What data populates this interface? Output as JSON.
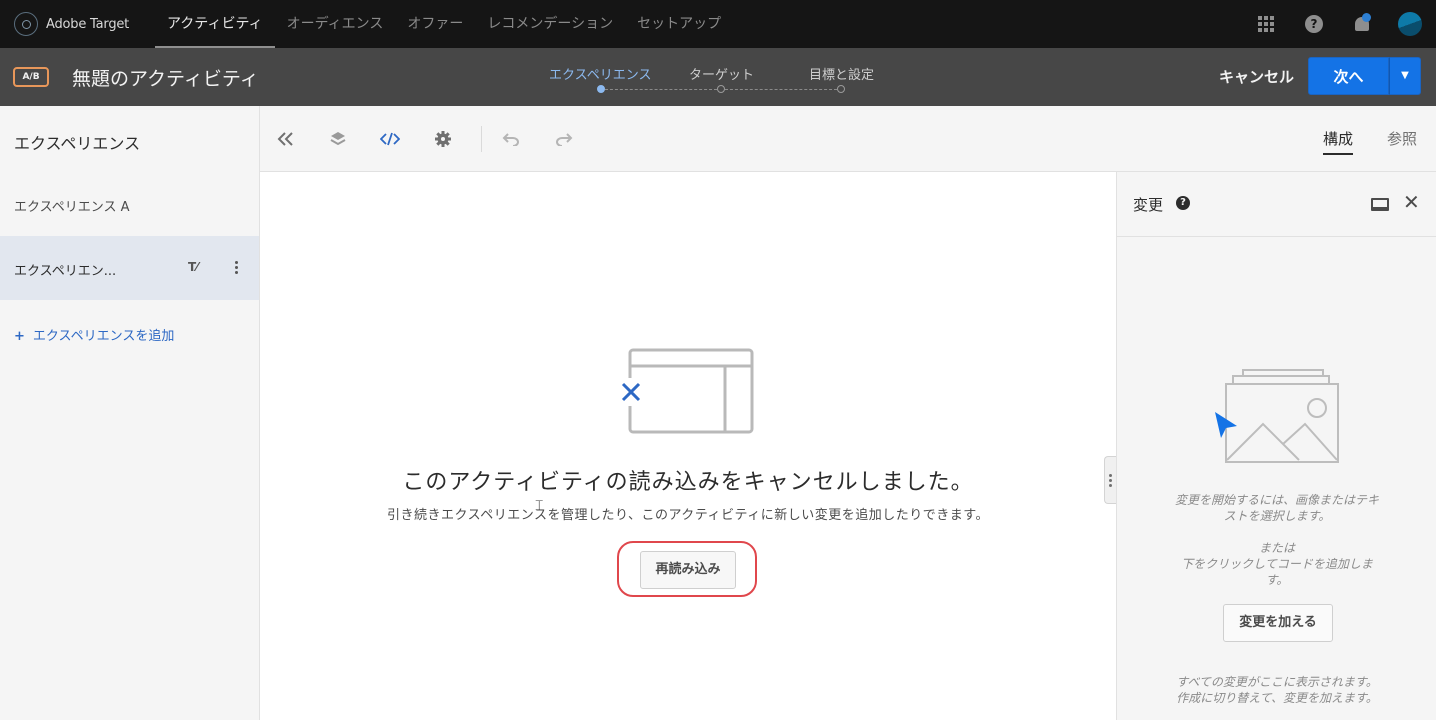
{
  "topnav": {
    "brand": "Adobe Target",
    "tabs": [
      "アクティビティ",
      "オーディエンス",
      "オファー",
      "レコメンデーション",
      "セットアップ"
    ],
    "active_tab": "アクティビティ"
  },
  "activity_bar": {
    "badge": "A/B",
    "title": "無題のアクティビティ",
    "steps": [
      {
        "label": "エクスペリエンス",
        "active": true
      },
      {
        "label": "ターゲット",
        "active": false
      },
      {
        "label": "目標と設定",
        "active": false
      }
    ],
    "cancel_label": "キャンセル",
    "next_label": "次へ"
  },
  "left_panel": {
    "title": "エクスペリエンス",
    "experiences": [
      {
        "label": "エクスペリエンス A",
        "selected": false
      },
      {
        "label": "エクスペリエン...",
        "selected": true
      }
    ],
    "add_label": "エクスペリエンスを追加"
  },
  "toolbar": {
    "view_tabs": [
      "構成",
      "参照"
    ],
    "active_view": "構成"
  },
  "canvas": {
    "heading": "このアクティビティの読み込みをキャンセルしました。",
    "subtext": "引き続きエクスペリエンスを管理したり、このアクティビティに新しい変更を追加したりできます。",
    "reload_label": "再読み込み"
  },
  "right_panel": {
    "title": "変更",
    "help_symbol": "?",
    "hint_line1": "変更を開始するには、画像またはテキ",
    "hint_line2": "ストを選択します。",
    "or_label": "または",
    "code_line1": "下をクリックしてコードを追加しま",
    "code_line2": "す。",
    "add_change_label": "変更を加える",
    "footer_line1": "すべての変更がここに表示されます。",
    "footer_line2": "作成に切り替えて、変更を加えます。"
  },
  "colors": {
    "accent_blue": "#1473e6",
    "link_blue": "#2d68c4",
    "highlight_red": "#e0474c",
    "ab_badge_orange": "#e8975a"
  }
}
